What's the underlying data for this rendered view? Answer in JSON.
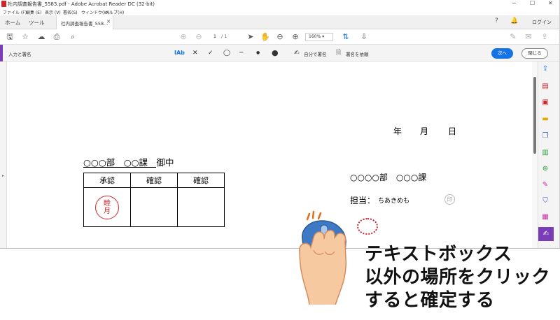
{
  "window": {
    "title": "社内調査報告書_5583.pdf - Adobe Acrobat Reader DC (32-bit)"
  },
  "menu": [
    "ファイル (F)",
    "編集 (E)",
    "表示 (V)",
    "署名(S)",
    "ウィンドウ(W)",
    "ヘルプ(H)"
  ],
  "tabs": {
    "home": "ホーム",
    "tools": "ツール",
    "document": "社内調査報告書_558..."
  },
  "login": "ログイン",
  "toolbar": {
    "page_current": "1",
    "page_total": "/ 1",
    "zoom": "160%"
  },
  "signbar": {
    "title": "入力と署名",
    "self_sign": "自分で署名",
    "request_sign": "署名を依頼",
    "next_button": "次へ",
    "close_button": "閉じる"
  },
  "document": {
    "date_year": "年",
    "date_month": "月",
    "date_day": "日",
    "addressee": "○○○部　○○課　御中",
    "approval_headers": [
      "承認",
      "確認",
      "確認"
    ],
    "stamp_top": "睦",
    "stamp_bottom": "月",
    "department": "○○○○部　○○○課",
    "person_label": "担当：",
    "person_name": "ちあきめも",
    "seal_faint": "印"
  },
  "annotation": {
    "line1": "テキストボックス",
    "line2": "以外の場所をクリック",
    "line3": "すると確定する"
  },
  "colors": {
    "accent_purple": "#7a3db8",
    "next_blue": "#1473e6",
    "stamp_red": "#d0232a"
  }
}
